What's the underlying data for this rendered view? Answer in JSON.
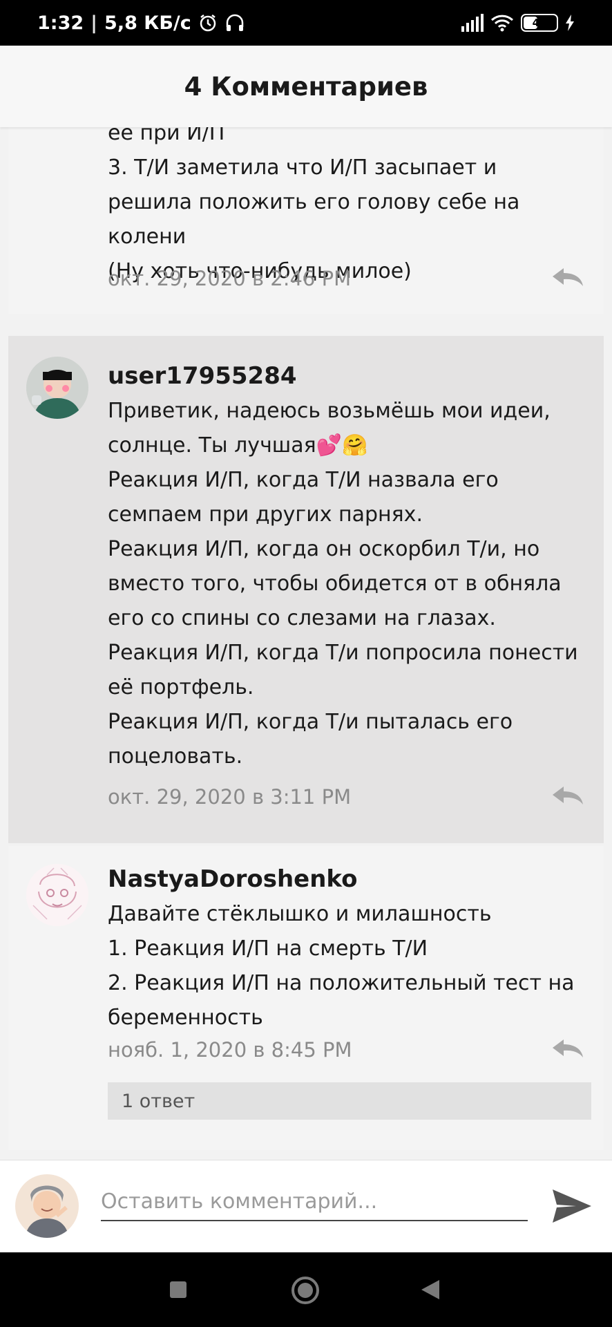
{
  "status_bar": {
    "time": "1:32",
    "speed": "5,8 КБ/с",
    "battery": "43",
    "battery_level": 0.43,
    "icons": [
      "alarm-icon",
      "headphones-icon",
      "signal-icon",
      "wifi-icon",
      "battery-icon",
      "charging-icon"
    ]
  },
  "header": {
    "title": "4 Комментариев"
  },
  "comments": [
    {
      "author": "",
      "text": "её при И/П\n3. Т/И заметила что И/П засыпает и решила положить его голову себе на колени\n(Ну хоть что-нибудь милое)",
      "date": "окт. 29, 2020 в 2:46 PM"
    },
    {
      "author": "user17955284",
      "text": "Приветик, надеюсь возьмёшь мои идеи, солнце. Ты лучшая💕🤗\nРеакция И/П, когда Т/И назвала его семпаем при других парнях.\nРеакция И/П, когда он оскорбил Т/и, но вместо того, чтобы обидется от в обняла его со спины со слезами на глазах.\nРеакция И/П, когда Т/и попросила понести её портфель.\nРеакция И/П, когда Т/и пыталась его поцеловать.",
      "date": "окт. 29, 2020 в 3:11 PM"
    },
    {
      "author": "NastyaDoroshenko",
      "text": "Давайте стёклышко и милашность\n1. Реакция И/П на смерть Т/И\n2. Реакция И/П на положительный тест на беременность",
      "date": "нояб. 1, 2020 в 8:45 PM",
      "replies": "1 ответ"
    }
  ],
  "input": {
    "placeholder": "Оставить комментарий..."
  },
  "nav": [
    "recents-button",
    "home-button",
    "back-button"
  ],
  "colors": {
    "highlight_bg": "#e4e3e3",
    "date_text": "#8a8a8a",
    "reply_icon": "#a8a8a8"
  }
}
